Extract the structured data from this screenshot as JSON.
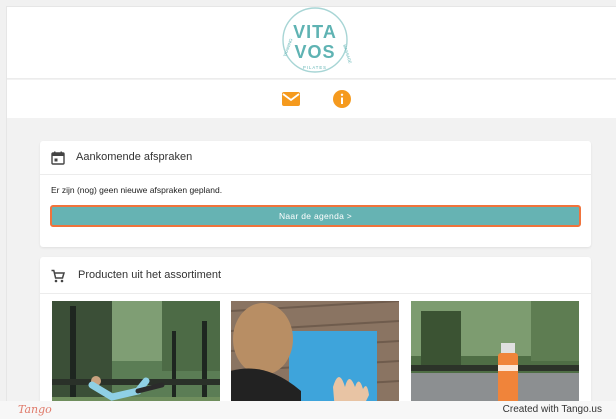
{
  "brand": {
    "word_top": "VITA",
    "word_bottom": "VOS",
    "ring_left": "TRAINING",
    "ring_bottom": "PILATES",
    "ring_right": "MASSAGE",
    "color": "#5fb3b3"
  },
  "nav": {
    "mail_icon": "mail-icon",
    "info_icon": "info-icon",
    "accent": "#f59a1e"
  },
  "appointments": {
    "title": "Aankomende afspraken",
    "icon": "calendar-icon",
    "message": "Er zijn (nog) geen nieuwe afspraken gepland.",
    "button_label": "Naar de agenda >",
    "button_color": "#66b3b3",
    "highlight_color": "#f0733c"
  },
  "products": {
    "title": "Producten uit het assortiment",
    "icon": "cart-icon",
    "items": [
      {
        "image": "woman doing pilates exercise in park"
      },
      {
        "image": "person on blue exercise mat"
      },
      {
        "image": "water bottle on outdoor path"
      }
    ]
  },
  "footer": {
    "tango": "Tango",
    "created": "Created with Tango.us"
  }
}
